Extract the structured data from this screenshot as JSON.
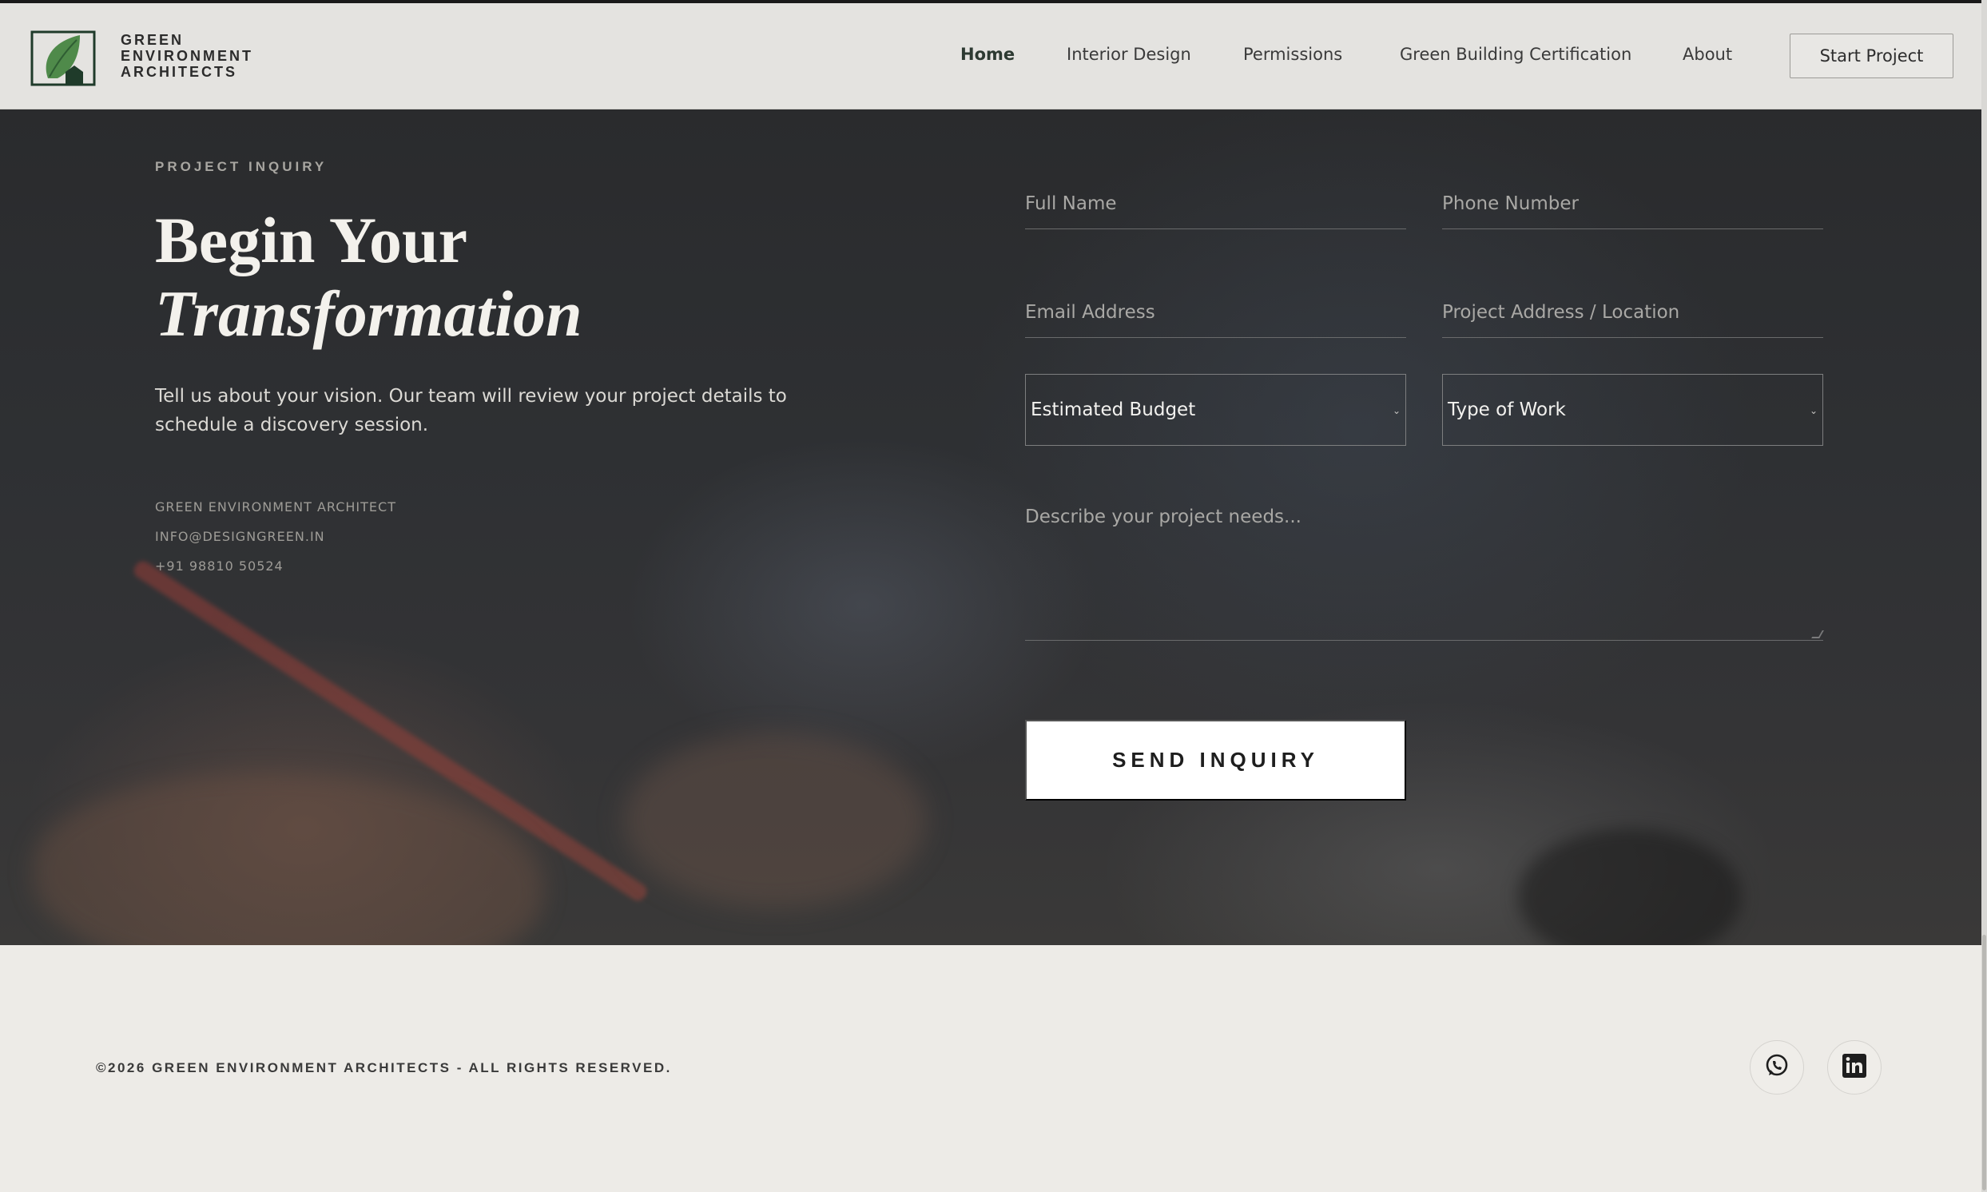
{
  "brand": {
    "line1": "GREEN",
    "line2": "ENVIRONMENT",
    "line3": "ARCHITECTS"
  },
  "nav": [
    {
      "label": "Home",
      "active": true
    },
    {
      "label": "Interior Design"
    },
    {
      "label": "Permissions"
    },
    {
      "label": "Green Building Certification"
    },
    {
      "label": "About"
    }
  ],
  "cta": "Start Project",
  "hero": {
    "eyebrow": "PROJECT INQUIRY",
    "title_line1": "Begin Your",
    "title_line2": "Transformation",
    "lede": "Tell us about your vision. Our team will review your project details to schedule a discovery session.",
    "contact": [
      "GREEN ENVIRONMENT ARCHITECT",
      "INFO@DESIGNGREEN.IN",
      "+91 98810 50524"
    ]
  },
  "form": {
    "full_name_placeholder": "Full Name",
    "phone_placeholder": "Phone Number",
    "email_placeholder": "Email Address",
    "address_placeholder": "Project Address / Location",
    "budget_value": "Estimated Budget",
    "work_type_value": "Type of Work",
    "description_placeholder": "Describe your project needs...",
    "submit": "SEND INQUIRY"
  },
  "footer": {
    "copyright": "©2026 GREEN ENVIRONMENT ARCHITECTS - ALL RIGHTS RESERVED.",
    "social": [
      "whatsapp-icon",
      "linkedin-icon"
    ]
  },
  "colors": {
    "accent_green": "#4f8a4a",
    "dark_green": "#1f3b2a",
    "button_bg": "#ffffff"
  }
}
